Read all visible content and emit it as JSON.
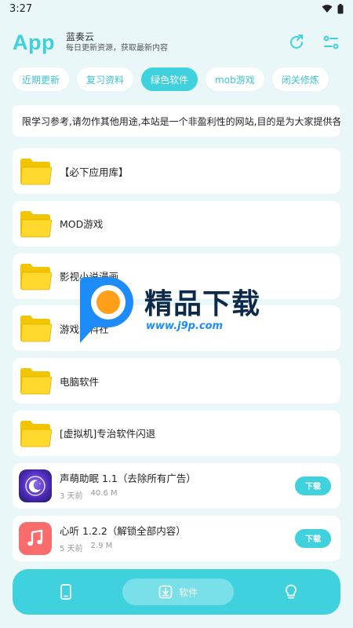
{
  "status": {
    "time": "3:27"
  },
  "header": {
    "app_title": "App",
    "sub_title": "蓝奏云",
    "sub_desc": "每日更新资源，获取最新内容"
  },
  "tabs": [
    {
      "label": "近期更新"
    },
    {
      "label": "复习资料"
    },
    {
      "label": "绿色软件",
      "active": true
    },
    {
      "label": "mob游戏"
    },
    {
      "label": "闭关修炼"
    }
  ],
  "notice": "限学习参考,请勿作其他用途,本站是一个非盈利性的网站,目的是为大家提供各类优秀",
  "folders": [
    {
      "name": "【必下应用库】"
    },
    {
      "name": "MOD游戏"
    },
    {
      "name": "影视小说漫画"
    },
    {
      "name": "游戏资料社"
    },
    {
      "name": "电脑软件"
    },
    {
      "name": "[虚拟机]专治软件闪退"
    }
  ],
  "apps": [
    {
      "name": "声萌助眠 1.1（去除所有广告）",
      "date": "3 天前",
      "size": "40.6 M",
      "button": "下载",
      "icon": "moon-sleep-icon"
    },
    {
      "name": "心听 1.2.2（解锁全部内容）",
      "date": "5 天前",
      "size": "2.9 M",
      "button": "下载",
      "icon": "music-note-icon"
    }
  ],
  "watermark": {
    "title": "精品下载",
    "url": "www.j9p.com"
  },
  "bottom_nav": {
    "active_label": "软件"
  },
  "colors": {
    "accent": "#3fd2de",
    "page_bg": "#eaf7f9",
    "folder": "#ffd21a"
  }
}
